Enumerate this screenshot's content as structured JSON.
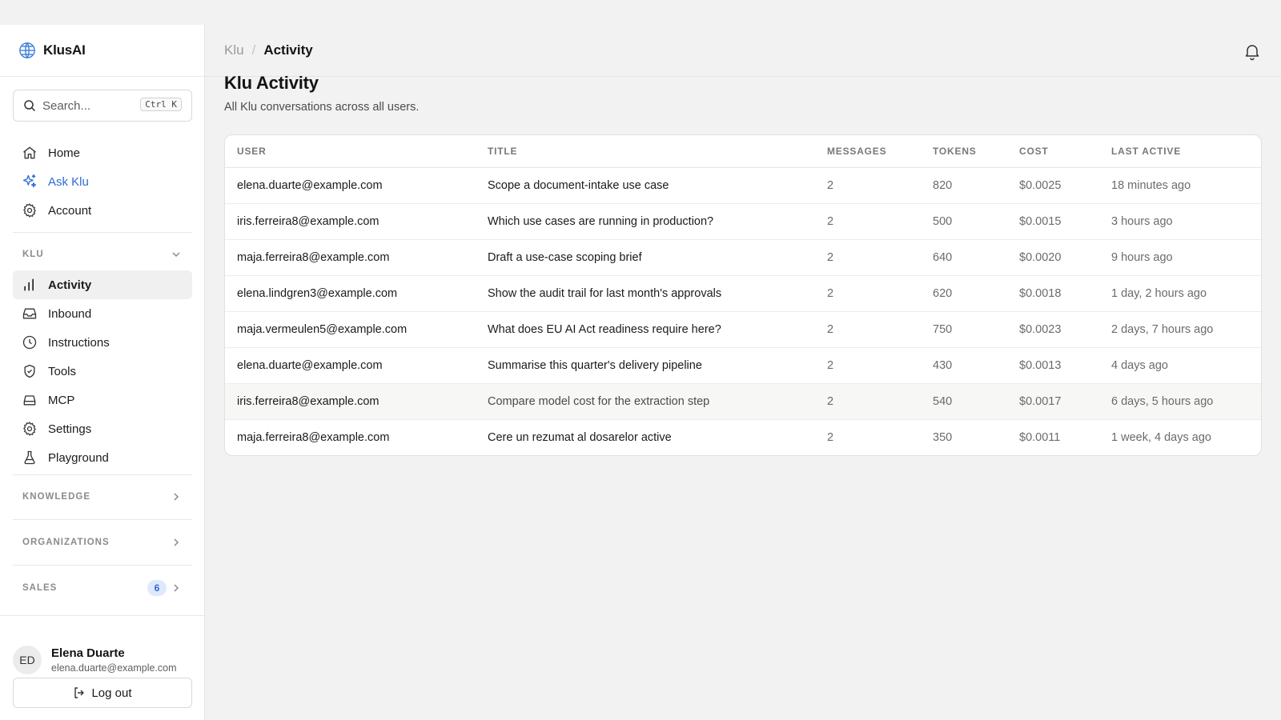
{
  "brand": {
    "name": "KlusAI"
  },
  "search": {
    "placeholder": "Search...",
    "shortcut": "Ctrl K"
  },
  "nav_primary": [
    {
      "label": "Home",
      "icon": "home-icon"
    },
    {
      "label": "Ask Klu",
      "icon": "sparkles-icon",
      "accent": "#2f6bd6"
    },
    {
      "label": "Account",
      "icon": "gear-icon"
    }
  ],
  "sections": {
    "klu": "KLU",
    "knowledge": "KNOWLEDGE",
    "organizations": "ORGANIZATIONS",
    "sales": "SALES",
    "sales_count": "6"
  },
  "nav_klu": [
    {
      "label": "Activity",
      "icon": "bar-chart-icon",
      "active": true
    },
    {
      "label": "Inbound",
      "icon": "inbox-icon"
    },
    {
      "label": "Instructions",
      "icon": "clock-icon"
    },
    {
      "label": "Tools",
      "icon": "shield-icon"
    },
    {
      "label": "MCP",
      "icon": "drive-icon"
    },
    {
      "label": "Settings",
      "icon": "gear-icon"
    },
    {
      "label": "Playground",
      "icon": "flask-icon"
    }
  ],
  "user": {
    "initials": "ED",
    "name": "Elena Duarte",
    "email": "elena.duarte@example.com"
  },
  "logout_label": "Log out",
  "breadcrumb": {
    "parent": "Klu",
    "separator": "/",
    "current": "Activity"
  },
  "page": {
    "title": "Klu Activity",
    "subtitle": "All Klu conversations across all users."
  },
  "table": {
    "columns": [
      "USER",
      "TITLE",
      "MESSAGES",
      "TOKENS",
      "COST",
      "LAST ACTIVE"
    ],
    "rows": [
      [
        "elena.duarte@example.com",
        "Scope a document-intake use case",
        "2",
        "820",
        "$0.0025",
        "18 minutes ago"
      ],
      [
        "iris.ferreira8@example.com",
        "Which use cases are running in production?",
        "2",
        "500",
        "$0.0015",
        "3 hours ago"
      ],
      [
        "maja.ferreira8@example.com",
        "Draft a use-case scoping brief",
        "2",
        "640",
        "$0.0020",
        "9 hours ago"
      ],
      [
        "elena.lindgren3@example.com",
        "Show the audit trail for last month's approvals",
        "2",
        "620",
        "$0.0018",
        "1 day, 2 hours ago"
      ],
      [
        "maja.vermeulen5@example.com",
        "What does EU AI Act readiness require here?",
        "2",
        "750",
        "$0.0023",
        "2 days, 7 hours ago"
      ],
      [
        "elena.duarte@example.com",
        "Summarise this quarter's delivery pipeline",
        "2",
        "430",
        "$0.0013",
        "4 days ago"
      ],
      [
        "iris.ferreira8@example.com",
        "Compare model cost for the extraction step",
        "2",
        "540",
        "$0.0017",
        "6 days, 5 hours ago"
      ],
      [
        "maja.ferreira8@example.com",
        "Cere un rezumat al dosarelor active",
        "2",
        "350",
        "$0.0011",
        "1 week, 4 days ago"
      ]
    ]
  }
}
